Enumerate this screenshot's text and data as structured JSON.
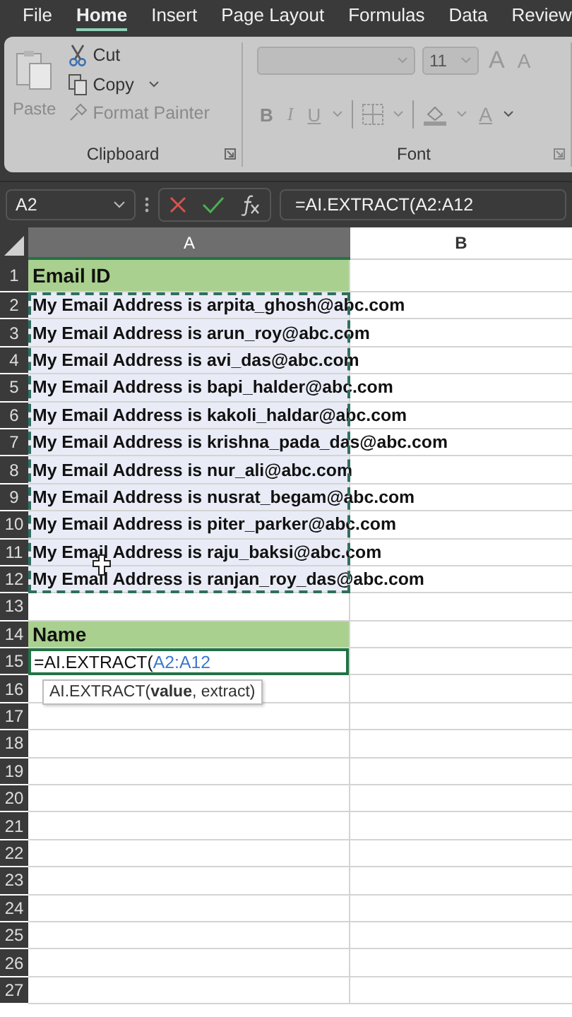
{
  "ribbon_tabs": [
    {
      "label": "File",
      "selected": false
    },
    {
      "label": "Home",
      "selected": true
    },
    {
      "label": "Insert",
      "selected": false
    },
    {
      "label": "Page Layout",
      "selected": false
    },
    {
      "label": "Formulas",
      "selected": false
    },
    {
      "label": "Data",
      "selected": false
    },
    {
      "label": "Review",
      "selected": false
    }
  ],
  "clipboard": {
    "paste": "Paste",
    "cut": "Cut",
    "copy": "Copy",
    "format_painter": "Format Painter",
    "group_label": "Clipboard"
  },
  "font": {
    "size": "11",
    "grow": "A",
    "shrink": "A",
    "bold": "B",
    "italic": "I",
    "underline": "U",
    "font_color": "A",
    "group_label": "Font"
  },
  "name_box": "A2",
  "formula": "=AI.EXTRACT(A2:A12",
  "columns": [
    "A",
    "B"
  ],
  "rows": [
    {
      "number": "1",
      "kind": "header",
      "text": "Email ID",
      "selected": false
    },
    {
      "number": "2",
      "kind": "data",
      "text": "My Email Address is arpita_ghosh@abc.com",
      "selected": true
    },
    {
      "number": "3",
      "kind": "data",
      "text": "My Email Address is arun_roy@abc.com",
      "selected": true
    },
    {
      "number": "4",
      "kind": "data",
      "text": "My Email Address is avi_das@abc.com",
      "selected": true
    },
    {
      "number": "5",
      "kind": "data",
      "text": "My Email Address is bapi_halder@abc.com",
      "selected": true
    },
    {
      "number": "6",
      "kind": "data",
      "text": "My Email Address is kakoli_haldar@abc.com",
      "selected": true
    },
    {
      "number": "7",
      "kind": "data",
      "text": "My Email Address is krishna_pada_das@abc.com",
      "selected": true
    },
    {
      "number": "8",
      "kind": "data",
      "text": "My Email Address is nur_ali@abc.com",
      "selected": true
    },
    {
      "number": "9",
      "kind": "data",
      "text": "My Email Address is nusrat_begam@abc.com",
      "selected": true
    },
    {
      "number": "10",
      "kind": "data",
      "text": "My Email Address is piter_parker@abc.com",
      "selected": true
    },
    {
      "number": "11",
      "kind": "data",
      "text": "My Email Address is raju_baksi@abc.com",
      "selected": true
    },
    {
      "number": "12",
      "kind": "data",
      "text": "My Email Address is ranjan_roy_das@abc.com",
      "selected": true
    },
    {
      "number": "13",
      "kind": "empty",
      "selected": false
    },
    {
      "number": "14",
      "kind": "header",
      "text": "Name",
      "selected": false
    },
    {
      "number": "15",
      "kind": "editing",
      "text": "=AI.EXTRACT(",
      "reference": "A2:A12",
      "tooltip": "AI.EXTRACT(**value**, extract)",
      "selected": false
    },
    {
      "number": "16",
      "kind": "empty",
      "selected": false
    },
    {
      "number": "17",
      "kind": "empty",
      "selected": false
    },
    {
      "number": "18",
      "kind": "empty",
      "selected": false
    },
    {
      "number": "19",
      "kind": "empty",
      "selected": false
    },
    {
      "number": "20",
      "kind": "empty",
      "selected": false
    },
    {
      "number": "21",
      "kind": "empty",
      "selected": false
    },
    {
      "number": "22",
      "kind": "empty",
      "selected": false
    },
    {
      "number": "23",
      "kind": "empty",
      "selected": false
    },
    {
      "number": "24",
      "kind": "empty",
      "selected": false
    },
    {
      "number": "25",
      "kind": "empty",
      "selected": false
    },
    {
      "number": "26",
      "kind": "empty",
      "selected": false
    },
    {
      "number": "27",
      "kind": "empty",
      "selected": false
    }
  ]
}
